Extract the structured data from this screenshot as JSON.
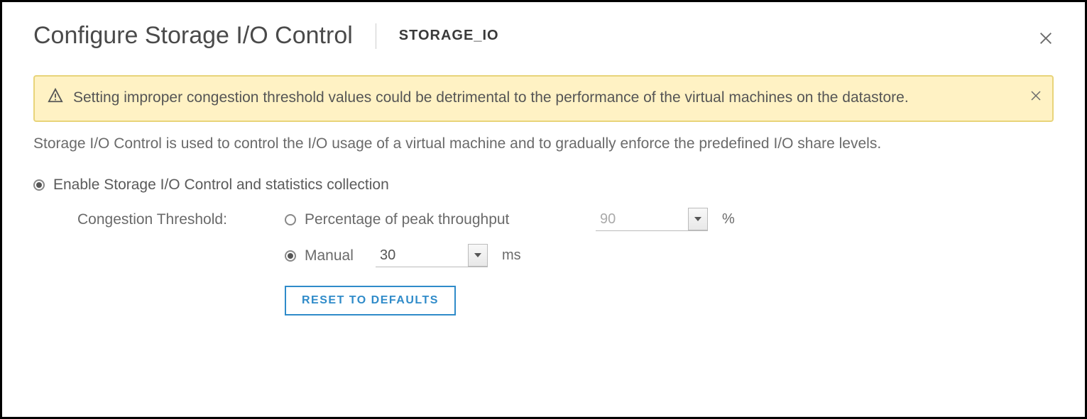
{
  "header": {
    "title": "Configure Storage I/O Control",
    "subtitle": "STORAGE_IO"
  },
  "alert": {
    "text": "Setting improper congestion threshold values could be detrimental to the performance of the virtual machines on the datastore."
  },
  "description": "Storage I/O Control is used to control the I/O usage of a virtual machine and to gradually enforce the predefined I/O share levels.",
  "options": {
    "enable_label": "Enable Storage I/O Control and statistics collection",
    "enable_selected": true,
    "threshold_label": "Congestion Threshold:",
    "percentage": {
      "label": "Percentage of peak throughput",
      "selected": false,
      "value": "90",
      "unit": "%"
    },
    "manual": {
      "label": "Manual",
      "selected": true,
      "value": "30",
      "unit": "ms"
    },
    "reset_label": "RESET TO DEFAULTS"
  }
}
